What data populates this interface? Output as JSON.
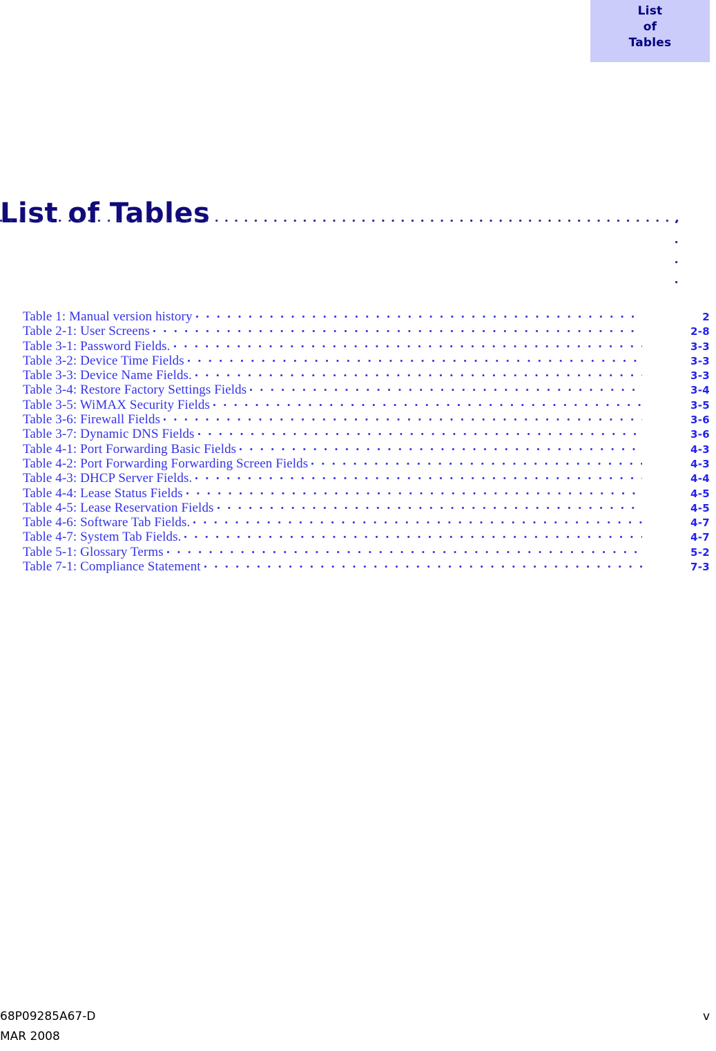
{
  "thumb_tab": {
    "line1": "List",
    "line2": "of",
    "line3": "Tables",
    "background_color": "#ccccfa",
    "text_color": "#000080"
  },
  "page_title": "List of Tables",
  "title_color": "#110a7a",
  "rule_dot_color": "#2a2a8c",
  "toc": {
    "entry_text_color": "#3333e6",
    "page_number_color": "#2222ee",
    "entries": [
      {
        "label": "Table 1: Manual version history",
        "page": "2"
      },
      {
        "label": "Table 2-1: User Screens",
        "page": "2-8"
      },
      {
        "label": "Table 3-1: Password Fields.",
        "page": "3-3"
      },
      {
        "label": "Table 3-2: Device Time Fields",
        "page": "3-3"
      },
      {
        "label": "Table 3-3: Device Name Fields.",
        "page": "3-3"
      },
      {
        "label": "Table 3-4: Restore Factory Settings Fields",
        "page": "3-4"
      },
      {
        "label": "Table 3-5: WiMAX Security Fields",
        "page": "3-5"
      },
      {
        "label": "Table 3-6: Firewall Fields",
        "page": "3-6"
      },
      {
        "label": "Table 3-7: Dynamic DNS Fields",
        "page": "3-6"
      },
      {
        "label": "Table 4-1: Port Forwarding Basic Fields",
        "page": "4-3"
      },
      {
        "label": "Table 4-2: Port Forwarding Forwarding Screen Fields",
        "page": "4-3"
      },
      {
        "label": "Table 4-3: DHCP Server Fields.",
        "page": "4-4"
      },
      {
        "label": "Table 4-4: Lease Status Fields",
        "page": "4-5"
      },
      {
        "label": "Table 4-5: Lease Reservation Fields",
        "page": "4-5"
      },
      {
        "label": "Table 4-6: Software Tab Fields.",
        "page": "4-7"
      },
      {
        "label": "Table 4-7: System Tab Fields.",
        "page": "4-7"
      },
      {
        "label": "Table 5-1: Glossary Terms",
        "page": "5-2"
      },
      {
        "label": "Table 7-1: Compliance Statement",
        "page": "7-3"
      }
    ]
  },
  "footer": {
    "document_number": "68P09285A67-D",
    "date": "MAR 2008",
    "page_number": "v"
  }
}
